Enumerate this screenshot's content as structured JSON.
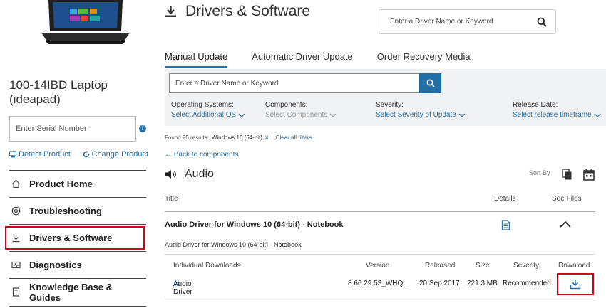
{
  "product": {
    "name": "100-14IBD Laptop (ideapad)",
    "serial_placeholder": "Enter Serial Number",
    "detect_label": "Detect Product",
    "change_label": "Change Product"
  },
  "sidebar": {
    "items": [
      {
        "label": "Product Home",
        "icon": "home-icon"
      },
      {
        "label": "Troubleshooting",
        "icon": "troubleshoot-icon"
      },
      {
        "label": "Drivers & Software",
        "icon": "download-icon",
        "active": true
      },
      {
        "label": "Diagnostics",
        "icon": "diagnostics-icon"
      },
      {
        "label": "Knowledge Base & Guides",
        "icon": "book-icon"
      }
    ]
  },
  "header": {
    "title": "Drivers & Software",
    "search_placeholder": "Enter a Driver Name or Keyword"
  },
  "tabs": [
    {
      "label": "Manual Update",
      "active": true
    },
    {
      "label": "Automatic Driver Update"
    },
    {
      "label": "Order Recovery Media"
    }
  ],
  "filters": {
    "search_placeholder": "Enter a Driver Name or Keyword",
    "os": {
      "label": "Operating Systems:",
      "value": "Select Additional OS"
    },
    "components": {
      "label": "Components:",
      "value": "Select Components"
    },
    "severity": {
      "label": "Severity:",
      "value": "Select Severity of Update"
    },
    "release": {
      "label": "Release Date:",
      "value": "Select release timeframe"
    }
  },
  "results": {
    "found": "Found 25 results:",
    "tag": "Windows 10 (64-bit)",
    "remove": "×",
    "divider": "|",
    "clear": "Clear all filters"
  },
  "back_link": "← Back to components",
  "section": {
    "title": "Audio",
    "sort_by": "Sort By"
  },
  "table": {
    "headers": {
      "title": "Title",
      "details": "Details",
      "see_files": "See Files"
    },
    "row": {
      "name": "Audio Driver for Windows 10 (64-bit) - Notebook",
      "subtitle": "Audio Driver for Windows 10 (64-bit) - Notebook"
    }
  },
  "downloads": {
    "headers": {
      "individual": "Individual Downloads",
      "version": "Version",
      "released": "Released",
      "size": "Size",
      "severity": "Severity",
      "download": "Download"
    },
    "items": [
      {
        "name": "Audio Driver",
        "version": "8.66.29.53_WHQL",
        "released": "20 Sep 2017",
        "size": "221.3 MB",
        "severity": "Recommended"
      }
    ]
  },
  "colors": {
    "accent": "#2370a8",
    "highlight": "#d0021b",
    "panel": "#f1f2f4"
  }
}
